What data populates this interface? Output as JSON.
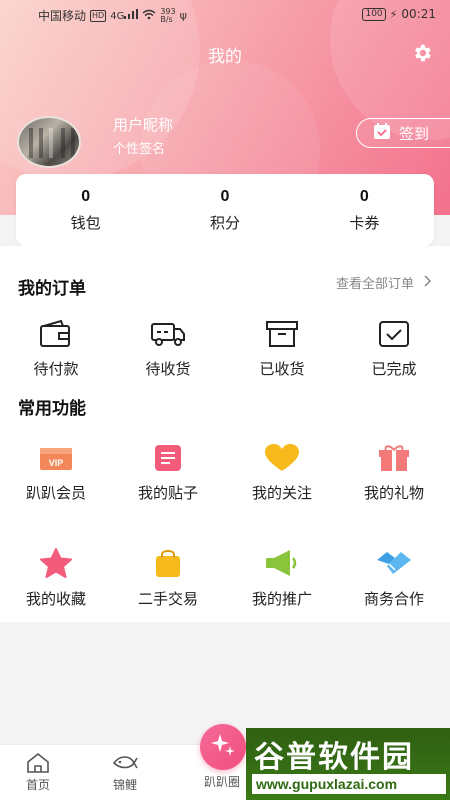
{
  "status_bar": {
    "carrier": "中国移动",
    "hd": "HD",
    "signal": "4G",
    "speed_value": "393",
    "speed_unit": "B/s",
    "battery": "100",
    "time": "00:21"
  },
  "header": {
    "title": "我的"
  },
  "profile": {
    "nickname": "用户昵称",
    "signature": "个性签名",
    "checkin_label": "签到"
  },
  "stats": [
    {
      "value": "0",
      "label": "钱包"
    },
    {
      "value": "0",
      "label": "积分"
    },
    {
      "value": "0",
      "label": "卡券"
    }
  ],
  "orders": {
    "title": "我的订单",
    "view_all": "查看全部订单",
    "items": [
      {
        "label": "待付款",
        "icon": "wallet-icon"
      },
      {
        "label": "待收货",
        "icon": "truck-icon"
      },
      {
        "label": "已收货",
        "icon": "box-icon"
      },
      {
        "label": "已完成",
        "icon": "checked-box-icon"
      }
    ]
  },
  "functions": {
    "title": "常用功能",
    "items": [
      {
        "label": "趴趴会员",
        "icon": "vip-card-icon",
        "color": "#f4875a"
      },
      {
        "label": "我的贴子",
        "icon": "note-icon",
        "color": "#f25c7a"
      },
      {
        "label": "我的关注",
        "icon": "heart-icon",
        "color": "#f7b91c"
      },
      {
        "label": "我的礼物",
        "icon": "gift-icon",
        "color": "#f47a7a"
      },
      {
        "label": "我的收藏",
        "icon": "star-icon",
        "color": "#f25c7a"
      },
      {
        "label": "二手交易",
        "icon": "shopping-bag-icon",
        "color": "#f7b91c"
      },
      {
        "label": "我的推广",
        "icon": "megaphone-icon",
        "color": "#8ac43a"
      },
      {
        "label": "商务合作",
        "icon": "handshake-icon",
        "color": "#3fa0e6"
      }
    ]
  },
  "bottom_nav": {
    "items": [
      {
        "label": "首页",
        "icon": "home-icon"
      },
      {
        "label": "锦鲤",
        "icon": "koi-icon"
      },
      {
        "label": "趴趴圈",
        "icon": "sparkle-icon"
      }
    ]
  },
  "watermark": {
    "main": "谷普软件园",
    "url": "www.gupuxlazai.com"
  }
}
